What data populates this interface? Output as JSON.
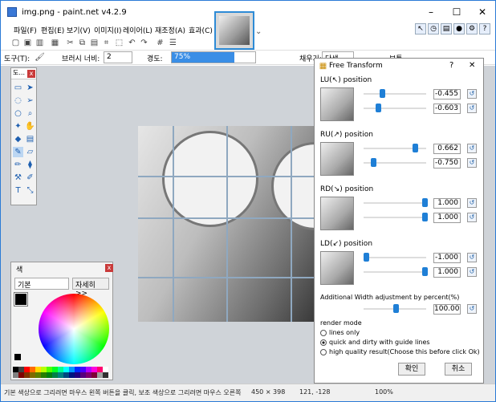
{
  "window": {
    "title": "img.png - paint.net v4.2.9"
  },
  "menubar": [
    "파일(F)",
    "편집(E)",
    "보기(V)",
    "이미지(I)",
    "레이어(L)",
    "재조정(A)",
    "효과(C)"
  ],
  "toolbar2": {
    "tool_label": "도구(T):",
    "brush_width_label": "브러시 너비:",
    "brush_width_value": "2",
    "hardness_label": "경도:",
    "hardness_value": "75%",
    "fill_label": "채우기:",
    "fill_value": "단색",
    "blend_value": "보통"
  },
  "tools_window": {
    "title": "도..."
  },
  "colors_window": {
    "title": "색",
    "palette_select": "기본",
    "more_button": "자세히 >>"
  },
  "dialog": {
    "title": "Free Transform",
    "help": "?",
    "close": "✕",
    "sections": [
      {
        "label": "LU(↖) position",
        "v1": "-0.455",
        "v2": "-0.603",
        "k1": 0.28,
        "k2": 0.2
      },
      {
        "label": "RU(↗) position",
        "v1": "0.662",
        "v2": "-0.750",
        "k1": 0.83,
        "k2": 0.12
      },
      {
        "label": "RD(↘) position",
        "v1": "1.000",
        "v2": "1.000",
        "k1": 1.0,
        "k2": 1.0
      },
      {
        "label": "LD(↙) position",
        "v1": "-1.000",
        "v2": "1.000",
        "k1": 0.0,
        "k2": 1.0
      }
    ],
    "width_adjust_label": "Additional Width adjustment by percent(%)",
    "width_adjust_value": "100.00",
    "width_adjust_knob": 0.5,
    "render_mode_label": "render mode",
    "render_options": [
      "lines only",
      "quick and dirty with guide lines",
      "high quality result(Choose this before click Ok)"
    ],
    "ok_button": "확인",
    "cancel_button": "취소"
  },
  "status": {
    "hint": "기본 색상으로 그리려면 마우스 왼쪽 버튼을 클릭, 보조 색상으로 그리려면 마우스 오른쪽 단추로 클릭 합니다.",
    "image_size": "450 × 398",
    "cursor_pos": "121, -128",
    "zoom": "100%"
  },
  "colors": {
    "accent": "#2e8bd6",
    "knob": "#1f7fd6",
    "close": "#c93a3a"
  }
}
